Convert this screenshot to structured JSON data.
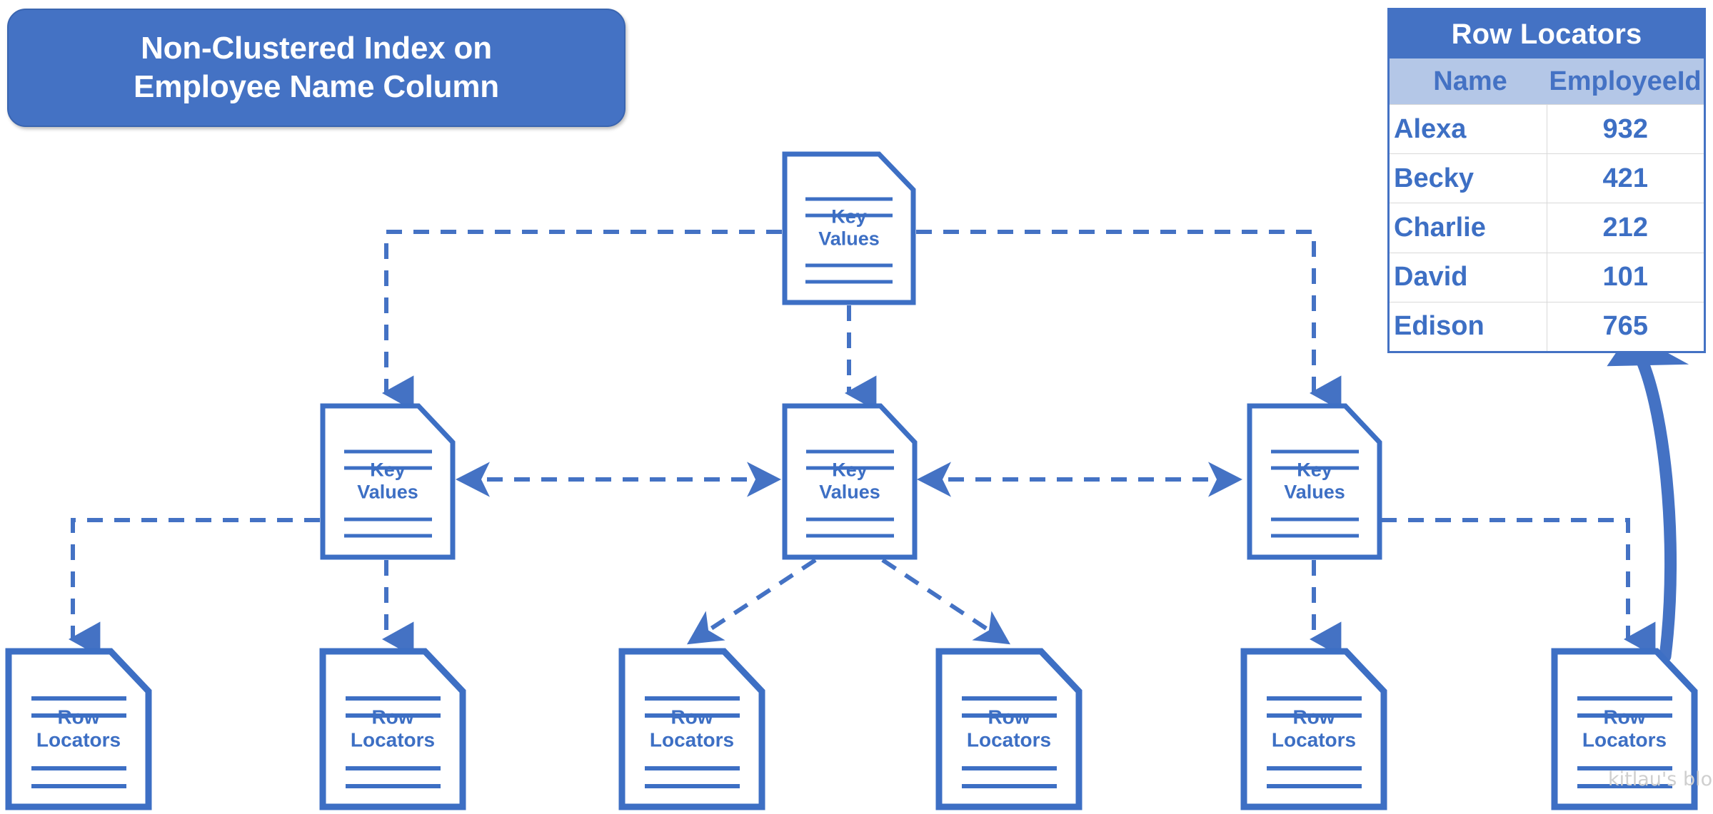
{
  "title": {
    "line1": "Non-Clustered Index on",
    "line2": "Employee Name Column"
  },
  "colors": {
    "accent": "#4472C4",
    "node_stroke": "#3D6FC4",
    "node_fill": "#FFFFFF",
    "table_header_bg": "#4472C4",
    "table_subheader_bg": "#B4C7E7",
    "text_on_accent": "#FFFFFF",
    "body_text": "#3D6FC4",
    "watermark": "#CFCFCF"
  },
  "tree": {
    "root": {
      "label_line1": "Key",
      "label_line2": "Values"
    },
    "level2": [
      {
        "label_line1": "Key",
        "label_line2": "Values"
      },
      {
        "label_line1": "Key",
        "label_line2": "Values"
      },
      {
        "label_line1": "Key",
        "label_line2": "Values"
      }
    ],
    "leaves": [
      {
        "label_line1": "Row",
        "label_line2": "Locators"
      },
      {
        "label_line1": "Row",
        "label_line2": "Locators"
      },
      {
        "label_line1": "Row",
        "label_line2": "Locators"
      },
      {
        "label_line1": "Row",
        "label_line2": "Locators"
      },
      {
        "label_line1": "Row",
        "label_line2": "Locators"
      },
      {
        "label_line1": "Row",
        "label_line2": "Locators"
      }
    ]
  },
  "row_locators_table": {
    "title": "Row Locators",
    "columns": [
      "Name",
      "EmployeeId"
    ],
    "rows": [
      {
        "name": "Alexa",
        "employee_id": "932"
      },
      {
        "name": "Becky",
        "employee_id": "421"
      },
      {
        "name": "Charlie",
        "employee_id": "212"
      },
      {
        "name": "David",
        "employee_id": "101"
      },
      {
        "name": "Edison",
        "employee_id": "765"
      }
    ]
  },
  "watermark": "kitlau's blog"
}
